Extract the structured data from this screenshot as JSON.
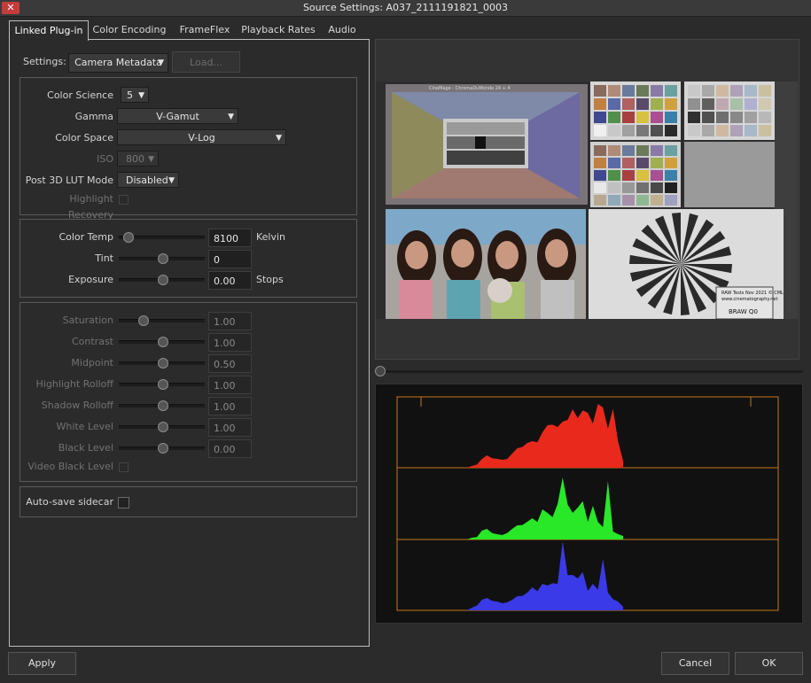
{
  "window": {
    "title": "Source Settings: A037_2111191821_0003",
    "close_glyph": "✕"
  },
  "tabs": [
    {
      "label": "Linked Plug-in",
      "active": true
    },
    {
      "label": "Color Encoding"
    },
    {
      "label": "FrameFlex"
    },
    {
      "label": "Playback Rates"
    },
    {
      "label": "Audio"
    }
  ],
  "settings": {
    "label": "Settings:",
    "value": "Camera Metadata",
    "load_label": "Load..."
  },
  "color": {
    "science_label": "Color Science",
    "science_value": "5",
    "gamma_label": "Gamma",
    "gamma_value": "V-Gamut",
    "space_label": "Color Space",
    "space_value": "V-Log",
    "iso_label": "ISO",
    "iso_value": "800",
    "lut_label": "Post 3D LUT Mode",
    "lut_value": "Disabled",
    "highlight_recovery_label": "Highlight Recovery"
  },
  "white": {
    "temp_label": "Color Temp",
    "temp_value": "8100",
    "temp_unit": "Kelvin",
    "temp_level": 0.06,
    "tint_label": "Tint",
    "tint_value": "0",
    "tint_level": 0.5,
    "exposure_label": "Exposure",
    "exposure_value": "0.00",
    "exposure_unit": "Stops",
    "exposure_level": 0.5
  },
  "tone": {
    "saturation_label": "Saturation",
    "saturation_value": "1.00",
    "saturation_level": 0.25,
    "contrast_label": "Contrast",
    "contrast_value": "1.00",
    "contrast_level": 0.5,
    "midpoint_label": "Midpoint",
    "midpoint_value": "0.50",
    "midpoint_level": 0.5,
    "hroll_label": "Highlight Rolloff",
    "hroll_value": "1.00",
    "hroll_level": 0.5,
    "sroll_label": "Shadow Rolloff",
    "sroll_value": "1.00",
    "sroll_level": 0.5,
    "white_label": "White Level",
    "white_value": "1.00",
    "white_level": 0.5,
    "black_label": "Black Level",
    "black_value": "0.00",
    "black_level": 0.5,
    "vblack_label": "Video Black Level"
  },
  "autosave": {
    "label": "Auto-save sidecar"
  },
  "preview": {
    "chart_title": "CineMage - ChromaDuMonde 24 + 4",
    "slate_lines": [
      "RAW Tests Nov 2021 © CML",
      "www.cinematography.net",
      "BRAW Q0"
    ],
    "scrub_level": 0.0
  },
  "histogram": {
    "colors": [
      "#e8291c",
      "#28e828",
      "#3a3ae8"
    ]
  },
  "buttons": {
    "apply": "Apply",
    "cancel": "Cancel",
    "ok": "OK"
  },
  "icons": {
    "dropdown": "▼"
  }
}
